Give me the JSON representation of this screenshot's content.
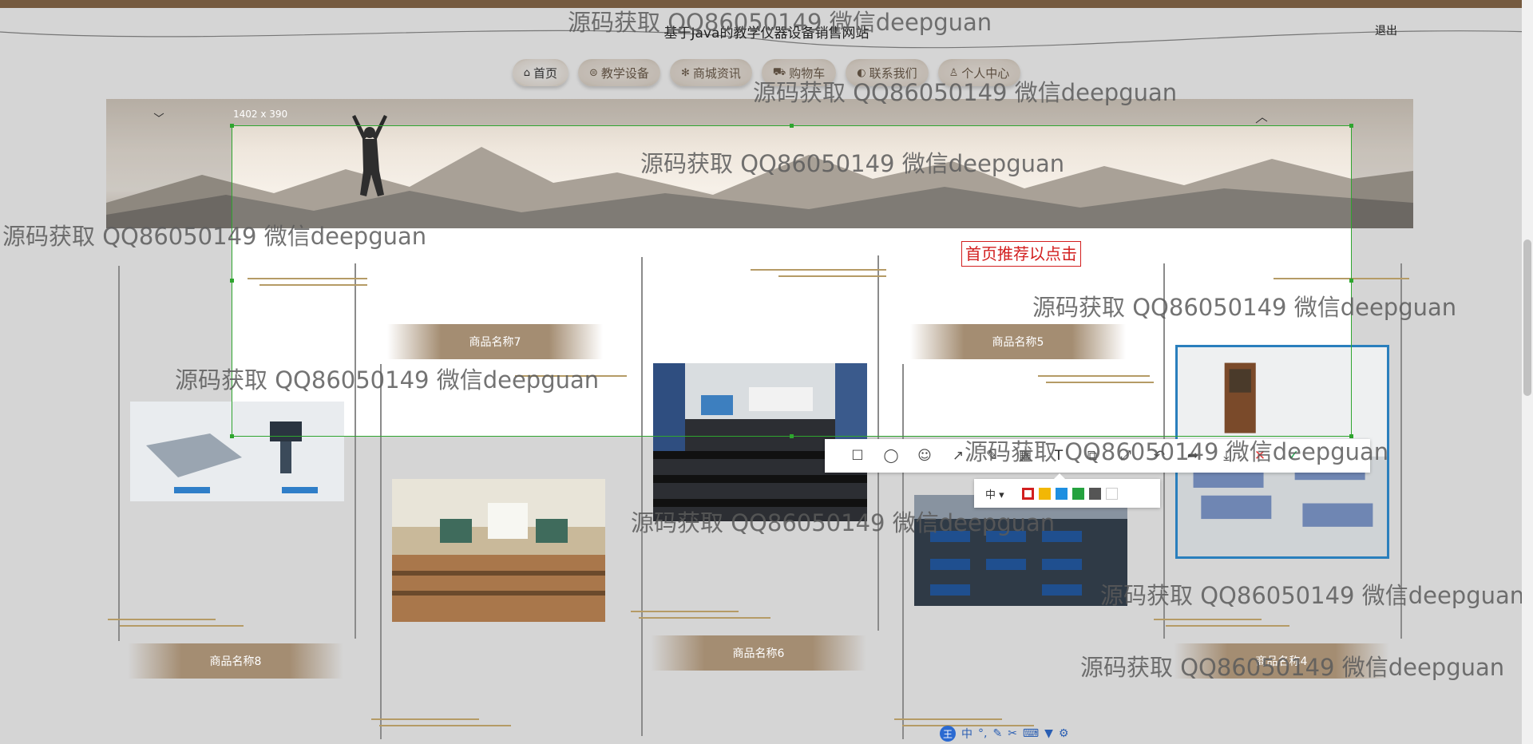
{
  "header": {
    "site_title": "基于Java的教学仪器设备销售网站",
    "logout_label": "退出"
  },
  "nav": [
    {
      "label": "首页",
      "icon": "home-icon",
      "active": true
    },
    {
      "label": "教学设备",
      "icon": "device-icon",
      "active": false
    },
    {
      "label": "商城资讯",
      "icon": "snowflake-icon",
      "active": false
    },
    {
      "label": "购物车",
      "icon": "cart-icon",
      "active": false
    },
    {
      "label": "联系我们",
      "icon": "chat-icon",
      "active": false
    },
    {
      "label": "个人中心",
      "icon": "user-icon",
      "active": false
    }
  ],
  "products": {
    "p7": "商品名称7",
    "p5": "商品名称5",
    "p8": "商品名称8",
    "p6": "商品名称6",
    "p4": "商品名称4"
  },
  "screenshot_tool": {
    "size_label": "1402 x 390",
    "annotation_text": "首页推荐以点击",
    "tools": [
      "rectangle-icon",
      "ellipse-icon",
      "emoji-icon",
      "arrow-icon",
      "pen-icon",
      "mosaic-icon",
      "text-icon",
      "copy-icon",
      "pin-icon",
      "undo-icon",
      "share-icon",
      "save-icon",
      "cancel-icon",
      "confirm-icon"
    ],
    "size_option": "中 ▾",
    "colors": [
      "#d21f1f",
      "#f2b705",
      "#1e8fe0",
      "#25a23f",
      "#555555",
      "#ffffff"
    ]
  },
  "watermark_text": "源码获取 QQ86050149 微信deepguan",
  "ime": {
    "logo": "王",
    "mode": "中"
  }
}
